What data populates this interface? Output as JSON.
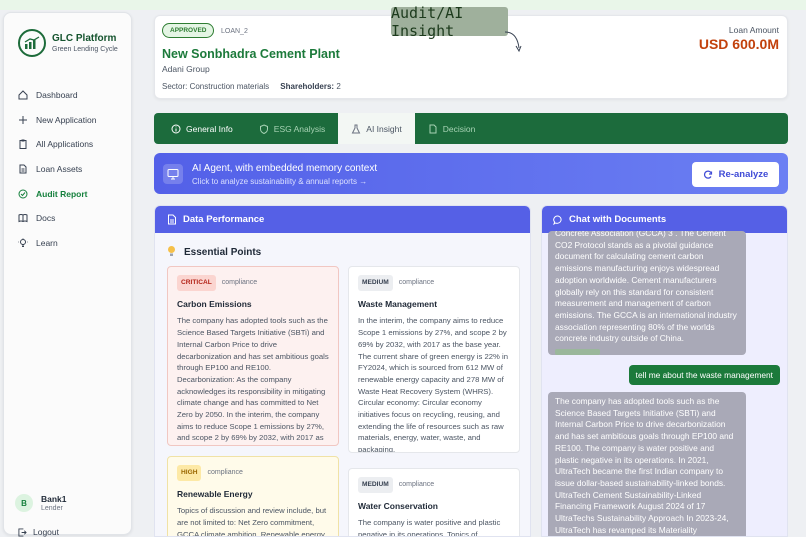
{
  "app": {
    "name": "GLC Platform",
    "tagline": "Green Lending Cycle"
  },
  "sidebar": {
    "items": [
      {
        "label": "Dashboard",
        "icon": "home-icon"
      },
      {
        "label": "New Application",
        "icon": "plus-icon"
      },
      {
        "label": "All Applications",
        "icon": "clipboard-icon"
      },
      {
        "label": "Loan Assets",
        "icon": "document-icon"
      },
      {
        "label": "Audit Report",
        "icon": "check-circle-icon",
        "active": true
      },
      {
        "label": "Docs",
        "icon": "book-icon"
      },
      {
        "label": "Learn",
        "icon": "lightbulb-icon"
      }
    ],
    "user": {
      "initial": "B",
      "name": "Bank1",
      "role": "Lender"
    },
    "logout_label": "Logout"
  },
  "header": {
    "status": "APPROVED",
    "loan_id": "LOAN_2",
    "company": "New Sonbhadra Cement Plant",
    "group": "Adani Group",
    "sector_label": "Sector:",
    "sector": "Construction materials",
    "shareholders_label": "Shareholders:",
    "shareholders": "2",
    "amount_label": "Loan Amount",
    "amount": "USD 600.0M",
    "overlay": "Audit/AI Insight"
  },
  "tabs": [
    {
      "label": "General Info",
      "icon": "info-icon"
    },
    {
      "label": "ESG Analysis",
      "icon": "shield-icon"
    },
    {
      "label": "AI Insight",
      "icon": "flask-icon",
      "active": true
    },
    {
      "label": "Decision",
      "icon": "file-icon"
    }
  ],
  "banner": {
    "title": "AI Agent, with embedded memory context",
    "subtitle": "Click to analyze sustainability & annual reports →",
    "button": "Re-analyze"
  },
  "data_performance": {
    "title": "Data Performance",
    "section_title": "Essential Points",
    "cards": [
      {
        "severity": "CRITICAL",
        "category": "compliance",
        "title": "Carbon Emissions",
        "body": "The company has adopted tools such as the Science Based Targets Initiative (SBTi) and Internal Carbon Price to drive decarbonization and has set ambitious goals through EP100 and RE100. Decarbonization: As the company acknowledges its responsibility in mitigating climate change and has committed to Net Zero by 2050. In the interim, the company aims to reduce Scope 1 emissions by 27%, and scope 2 by 69% by 2032, with 2017 as the base year."
      },
      {
        "severity": "MEDIUM",
        "category": "compliance",
        "title": "Waste Management",
        "body": "In the interim, the company aims to reduce Scope 1 emissions by 27%, and scope 2 by 69% by 2032, with 2017 as the base year. The current share of green energy is 22% in FY2024, which is sourced from 612 MW of renewable energy capacity and 278 MW of Waste Heat Recovery System (WHRS). Circular economy: Circular economy initiatives focus on recycling, reusing, and extending the life of resources such as raw materials, energy, water, waste, and packaging."
      },
      {
        "severity": "HIGH",
        "category": "compliance",
        "title": "Renewable Energy",
        "body": "Topics of discussion and review include, but are not limited to: Net Zero commitment, GCCA climate ambition, Renewable energy targets, Science Based Target initiative"
      },
      {
        "severity": "MEDIUM",
        "category": "compliance",
        "title": "Water Conservation",
        "body": "The company is water positive and plastic negative in its operations. Topics of discussion and review include, but are not"
      }
    ]
  },
  "chat": {
    "title": "Chat with Documents",
    "bot_msg_1": "Concrete Association (GCCA) 3 . The Cement CO2 Protocol stands as a pivotal guidance document for calculating cement carbon emissions manufacturing enjoys widespread adoption worldwide. Cement manufacturers globally rely on this standard for consistent measurement and management of carbon emissions. The GCCA is an international industry association representing 80% of the worlds concrete industry outside of China.",
    "user_msg": "tell me about the waste management",
    "bot_msg_2": "The company has adopted tools such as the Science Based Targets Initiative (SBTi) and Internal Carbon Price to drive decarbonization and has set ambitious goals through EP100 and RE100. The company is water positive and plastic negative in its operations. In 2021, UltraTech became the first Indian company to issue dollar-based sustainability-linked bonds. UltraTech Cement Sustainability-Linked Financing Framework August 2024 of 17 UltraTechs Sustainability Approach In 2023-24, UltraTech has revamped its Materiality Assessment, adopting the Double Materiality process per"
  }
}
